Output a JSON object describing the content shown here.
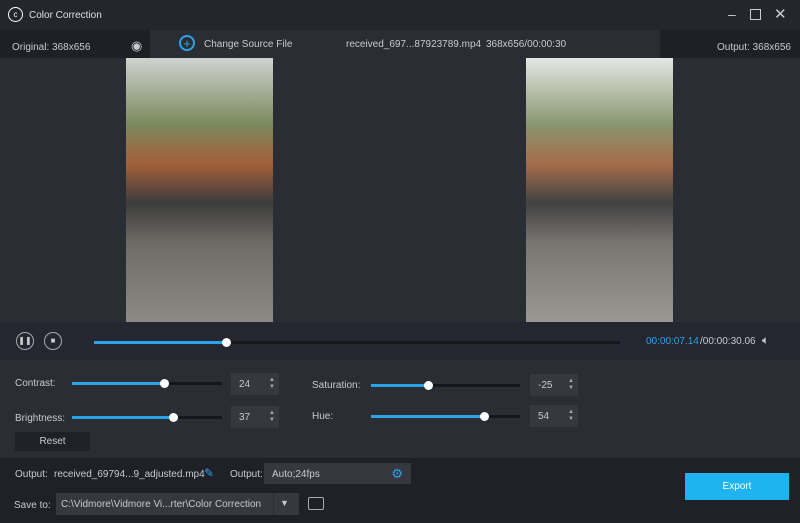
{
  "window": {
    "title": "Color Correction",
    "icons": [
      "app-logo-icon",
      "minimize-icon",
      "maximize-icon",
      "close-icon"
    ]
  },
  "topbar": {
    "original": "Original: 368x656",
    "change_source": "Change Source File",
    "file_name": "received_697...87923789.mp4",
    "file_info": "368x656/00:00:30",
    "output": "Output: 368x656"
  },
  "player": {
    "current_time": "00:00:07.14",
    "total_time": "/00:00:30.06",
    "progress": 0.25
  },
  "adjust": {
    "contrast": {
      "label": "Contrast:",
      "value": "24",
      "fraction": 0.61
    },
    "brightness": {
      "label": "Brightness:",
      "value": "37",
      "fraction": 0.67
    },
    "saturation": {
      "label": "Saturation:",
      "value": "-25",
      "fraction": 0.38
    },
    "hue": {
      "label": "Hue:",
      "value": "54",
      "fraction": 0.76
    },
    "reset": "Reset"
  },
  "bottom": {
    "output_label": "Output:",
    "output_file": "received_69794...9_adjusted.mp4",
    "format_label": "Output:",
    "format_value": "Auto;24fps",
    "save_label": "Save to:",
    "save_path": "C:\\Vidmore\\Vidmore Vi...rter\\Color Correction",
    "export": "Export"
  },
  "colors": {
    "accent": "#2aa4e8",
    "export_bg": "#1fb4f0"
  }
}
